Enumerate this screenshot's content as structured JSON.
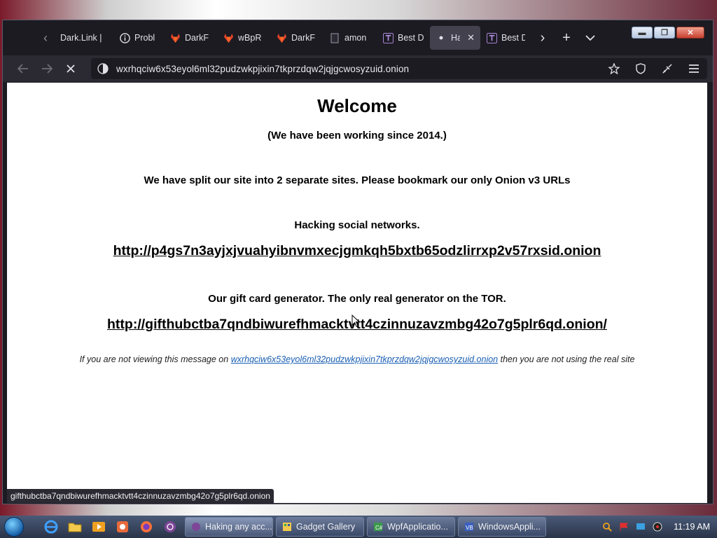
{
  "browser": {
    "tabs": [
      {
        "label": "Dark.Link |",
        "icon": "darklink-icon",
        "active": false
      },
      {
        "label": "Probl",
        "icon": "info-icon",
        "active": false
      },
      {
        "label": "DarkF",
        "icon": "gitlab-fox-icon",
        "active": false
      },
      {
        "label": "wBpR",
        "icon": "gitlab-fox-icon",
        "active": false
      },
      {
        "label": "DarkF",
        "icon": "gitlab-fox-icon",
        "active": false
      },
      {
        "label": "amon",
        "icon": "page-icon",
        "active": false
      },
      {
        "label": "Best D",
        "icon": "t-icon",
        "active": false
      },
      {
        "label": "Hac",
        "icon": "loading-dot-icon",
        "active": true
      },
      {
        "label": "Best D",
        "icon": "t-icon",
        "active": false
      }
    ],
    "url": "wxrhqciw6x53eyol6ml32pudzwkpjixin7tkprzdqw2jqjgcwosyzuid.onion",
    "status_url": "gifthubctba7qndbiwurefhmacktvtt4czinnuzavzmbg42o7g5plr6qd.onion"
  },
  "page": {
    "title": "Welcome",
    "since": "(We have been working since 2014.)",
    "split_notice": "We have split our site into 2 separate sites. Please bookmark our only Onion v3 URLs",
    "section1_heading": "Hacking social networks.",
    "section1_link": "http://p4gs7n3ayjxjvuahyibnvmxecjgmkqh5bxtb65odzlirrxp2v57rxsid.onion",
    "section2_heading": "Our gift card generator. The only real generator on the TOR.",
    "section2_link": "http://gifthubctba7qndbiwurefhmacktvtt4czinnuzavzmbg42o7g5plr6qd.onion/",
    "footer_prefix": "If you are not viewing this message on",
    "footer_link": "wxrhqciw6x53eyol6ml32pudzwkpjixin7tkprzdqw2jqjgcwosyzuid.onion",
    "footer_suffix": "then you are not using the real site"
  },
  "taskbar": {
    "tasks": [
      {
        "label": "Haking any acc...",
        "icon": "tor-icon",
        "active": true
      },
      {
        "label": "Gadget Gallery",
        "icon": "gadget-icon",
        "active": false
      },
      {
        "label": "WpfApplicatio...",
        "icon": "cs-icon",
        "active": false
      },
      {
        "label": "WindowsAppli...",
        "icon": "vb-icon",
        "active": false
      }
    ],
    "clock": "11:19 AM"
  },
  "colors": {
    "link": "#1a5fb4",
    "browser_bg": "#1c1b22",
    "toolbar_bg": "#2b2a33"
  }
}
